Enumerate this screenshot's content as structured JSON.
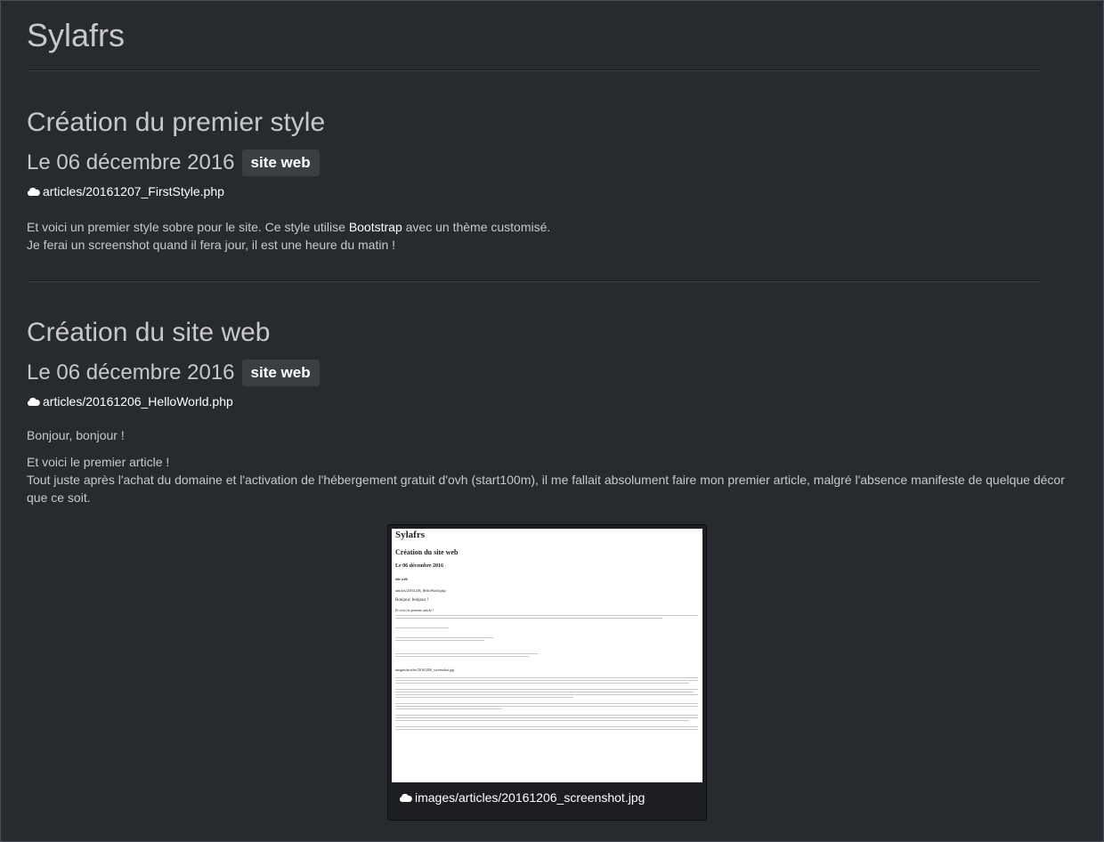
{
  "site": {
    "title": "Sylafrs"
  },
  "articles": [
    {
      "title": "Création du premier style",
      "date": "Le 06 décembre 2016",
      "tag": "site web",
      "file": "articles/20161207_FirstStyle.php",
      "paragraph1_before": "Et voici un premier style sobre pour le site. Ce style utilise ",
      "paragraph1_link": "Bootstrap",
      "paragraph1_after": " avec un thème customisé.",
      "paragraph2": "Je ferai un screenshot quand il fera jour, il est une heure du matin !"
    },
    {
      "title": "Création du site web",
      "date": "Le 06 décembre 2016",
      "tag": "site web",
      "file": "articles/20161206_HelloWorld.php",
      "greeting": "Bonjour, bonjour !",
      "intro": "Et voici le premier article !",
      "body": "Tout juste après l'achat du domaine et l'activation de l'hébergement gratuit d'ovh (start100m), il me fallait absolument faire mon premier article, malgré l'absence manifeste de quelque décor que ce soit.",
      "image_caption": "images/articles/20161206_screenshot.jpg"
    }
  ],
  "screenshot_preview": {
    "site_title": "Sylafrs",
    "article_title": "Création du site web",
    "date": "Le 06 décembre 2016",
    "tag": "site web",
    "file": "articles/20161206_HelloWorld.php",
    "greeting": "Bonjour, bonjour !",
    "intro": "Et voici le premier article !",
    "image_path": "images/articles/20161206_screenshot.jpg"
  },
  "icons": {
    "file_icon": "cloud-icon"
  }
}
